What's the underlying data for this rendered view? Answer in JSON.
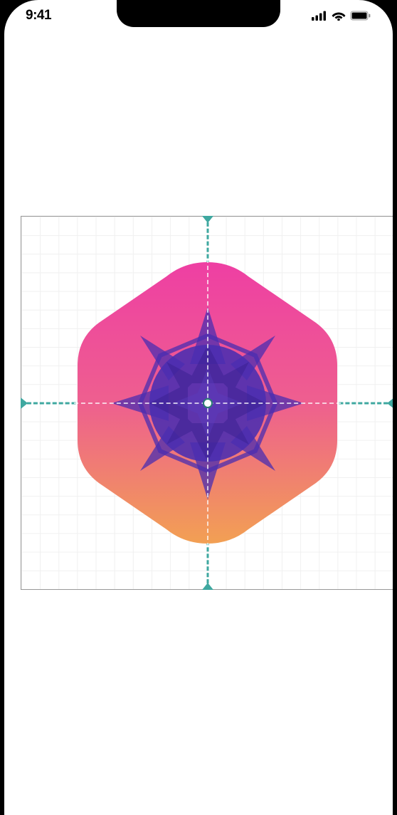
{
  "status_bar": {
    "time": "9:41"
  },
  "canvas": {
    "guide_color": "#3fa8a0",
    "gradient_top": "#ee3fa3",
    "gradient_bottom": "#f2a053",
    "shape_color": "#4a2db0"
  }
}
